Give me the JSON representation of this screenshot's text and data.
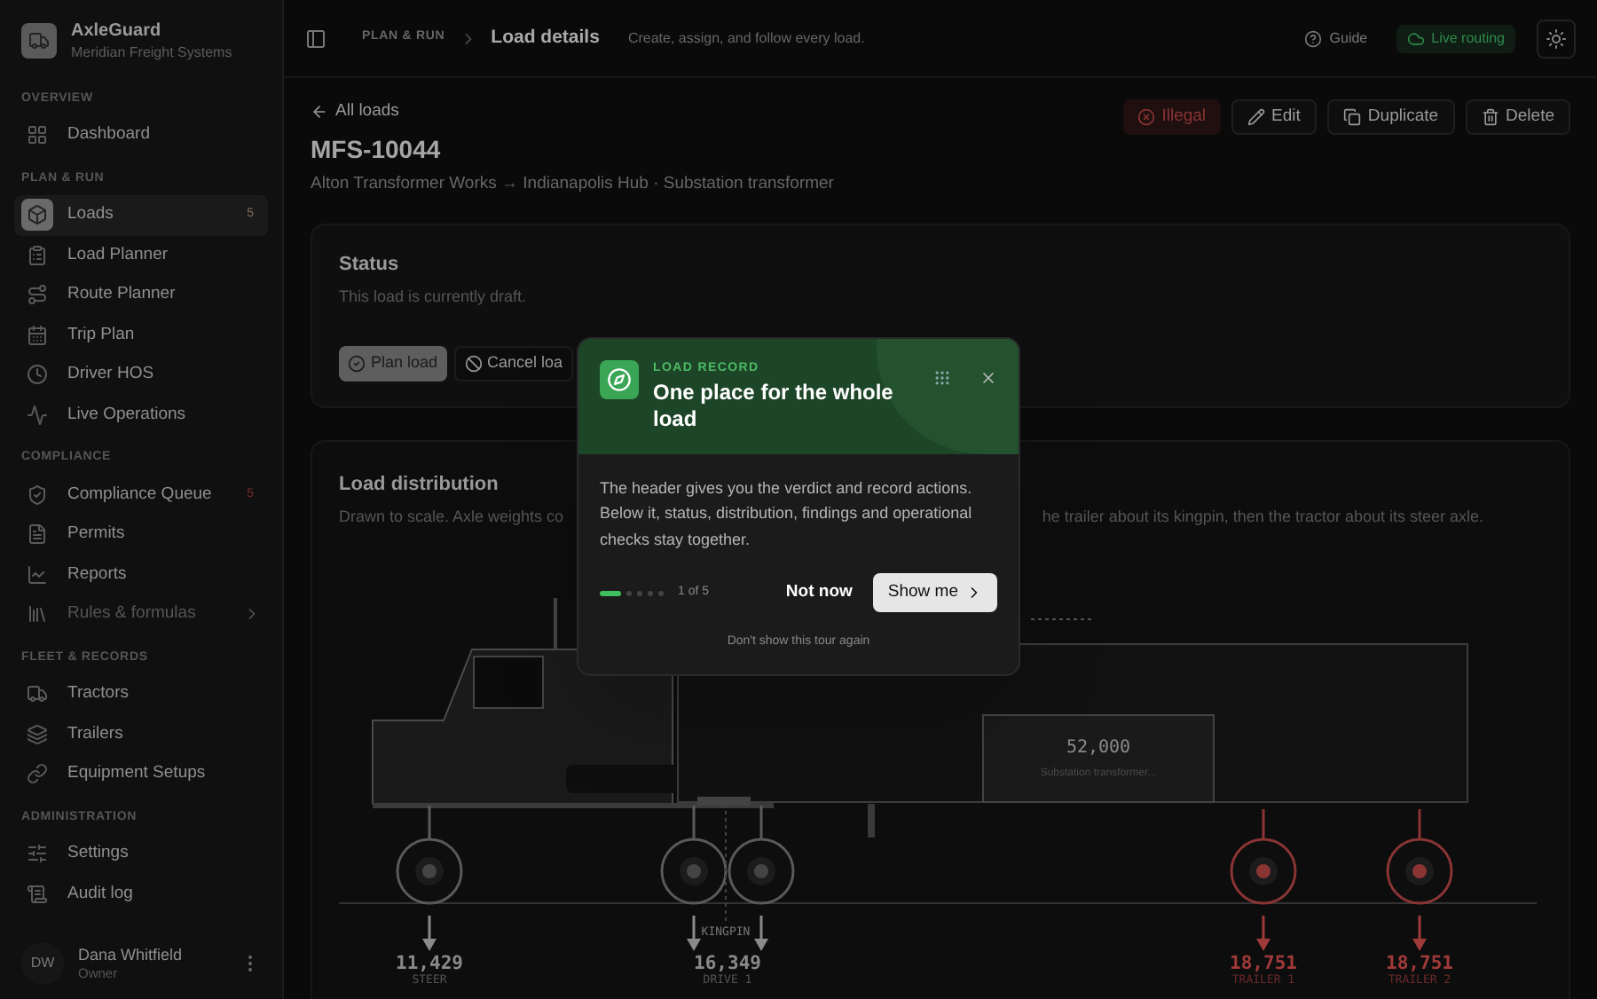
{
  "brand": {
    "name": "AxleGuard",
    "org": "Meridian Freight Systems"
  },
  "nav": [
    {
      "heading": "OVERVIEW",
      "items": [
        {
          "label": "Dashboard",
          "selected": false
        }
      ]
    },
    {
      "heading": "PLAN & RUN",
      "items": [
        {
          "label": "Loads",
          "selected": true,
          "badge": "5"
        },
        {
          "label": "Load Planner",
          "selected": false
        },
        {
          "label": "Route Planner",
          "selected": false
        },
        {
          "label": "Trip Plan",
          "selected": false
        },
        {
          "label": "Driver HOS",
          "selected": false
        },
        {
          "label": "Live Operations",
          "selected": false
        }
      ]
    },
    {
      "heading": "COMPLIANCE",
      "items": [
        {
          "label": "Compliance Queue",
          "selected": false,
          "badge": "5"
        },
        {
          "label": "Permits",
          "selected": false
        },
        {
          "label": "Reports",
          "selected": false
        },
        {
          "label": "Rules & formulas",
          "selected": false,
          "disabled": true,
          "expandable": true
        }
      ]
    },
    {
      "heading": "FLEET & RECORDS",
      "items": [
        {
          "label": "Tractors",
          "selected": false
        },
        {
          "label": "Trailers",
          "selected": false
        },
        {
          "label": "Equipment Setups",
          "selected": false
        }
      ]
    },
    {
      "heading": "ADMINISTRATION",
      "items": [
        {
          "label": "Settings",
          "selected": false
        },
        {
          "label": "Audit log",
          "selected": false
        }
      ]
    }
  ],
  "user": {
    "initials": "DW",
    "name": "Dana Whitfield",
    "role": "Owner"
  },
  "topbar": {
    "section": "PLAN & RUN",
    "page": "Load details",
    "subtitle": "Create, assign, and follow every load.",
    "guide": "Guide",
    "live": "Live routing"
  },
  "load": {
    "back": "All loads",
    "id": "MFS-10044",
    "route": "Alton Transformer Works → Indianapolis Hub · Substation transformer",
    "verdict": "Illegal",
    "actions": [
      "Edit",
      "Duplicate",
      "Delete"
    ]
  },
  "status": {
    "title": "Status",
    "text": "This load is currently draft.",
    "buttons": [
      {
        "label": "Plan load",
        "primary": true
      },
      {
        "label": "Cancel loa",
        "primary": false
      }
    ]
  },
  "distribution": {
    "title": "Load distribution",
    "text_left": "Drawn to scale. Axle weights co",
    "text_right": "he trailer about its kingpin, then the tractor about its steer axle.",
    "cargo": {
      "weight": "52,000",
      "name": "Substation transformer..."
    },
    "kingpin": "KINGPIN",
    "axles": [
      {
        "weight": "11,429",
        "label": "STEER",
        "overweight": false
      },
      {
        "weight": "16,349",
        "label": "DRIVE 1",
        "overweight": false
      },
      {
        "weight": "18,751",
        "label": "TRAILER 1",
        "overweight": true
      },
      {
        "weight": "18,751",
        "label": "TRAILER 2",
        "overweight": true
      }
    ]
  },
  "tour": {
    "eyebrow": "LOAD RECORD",
    "title": "One place for the whole load",
    "body": "The header gives you the verdict and record actions. Below it, status, distribution, findings and operational checks stay together.",
    "steps": [
      {
        "selected": true
      },
      {
        "selected": false
      },
      {
        "selected": false
      },
      {
        "selected": false
      },
      {
        "selected": false
      }
    ],
    "step": "1 of 5",
    "secondary": "Not now",
    "primary": "Show me",
    "dismiss": "Don't show this tour again"
  }
}
